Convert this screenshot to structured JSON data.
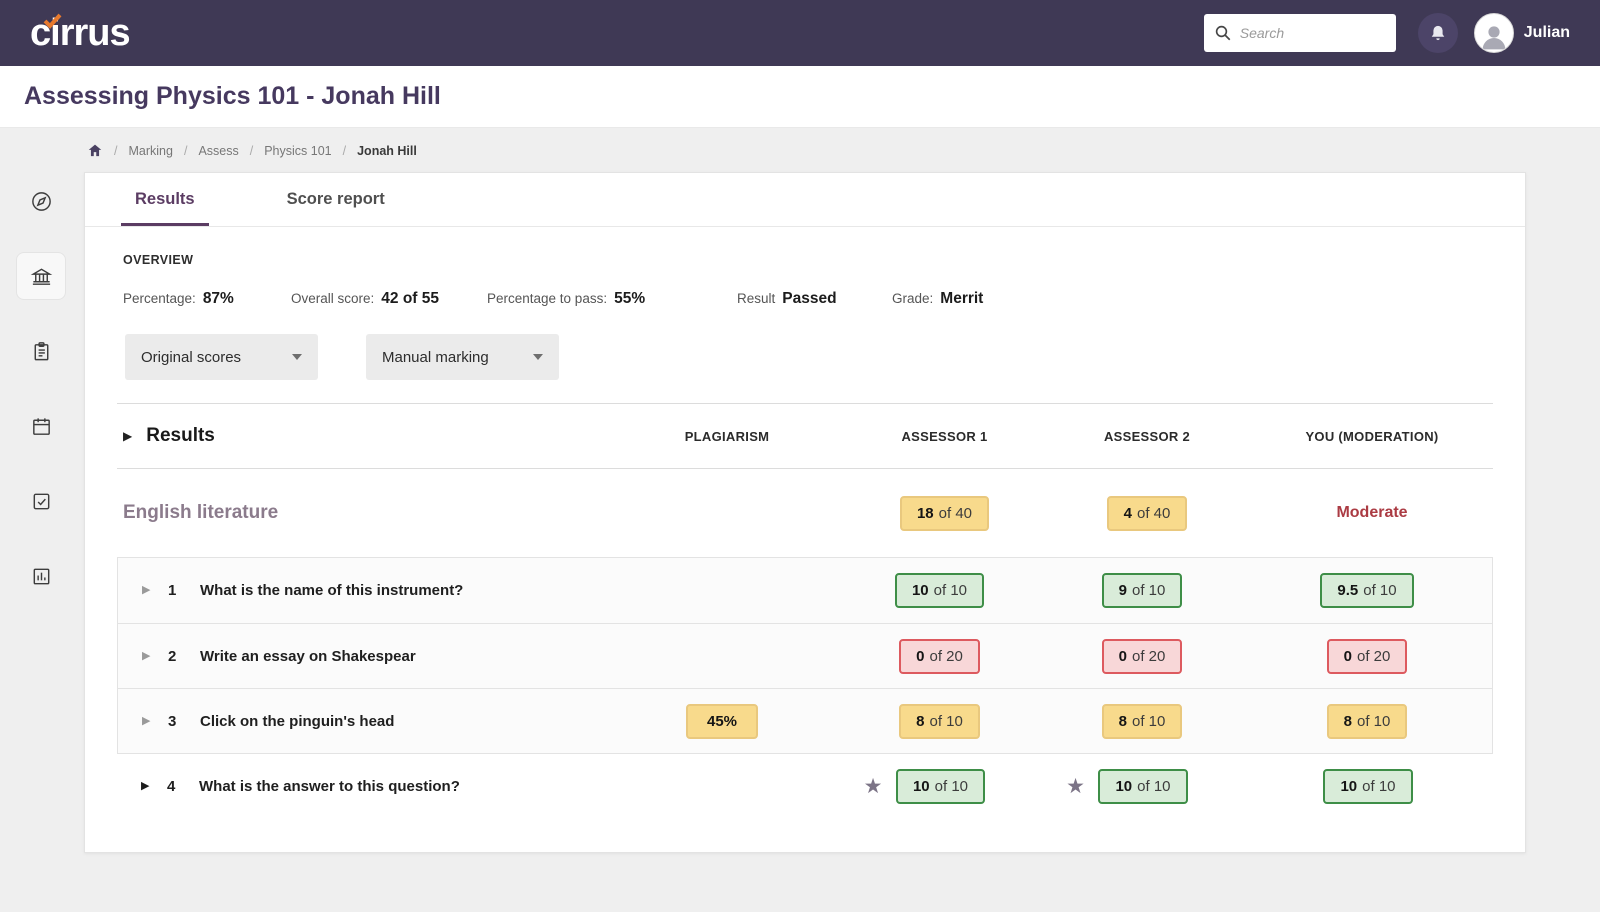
{
  "colors": {
    "topbar_bg": "#3f3955",
    "accent_purple": "#5b3c63",
    "badge_green_border": "#3e8e47",
    "badge_green_bg": "#d9ecd9",
    "badge_red_border": "#dd5a5f",
    "badge_red_bg": "#f8d7d8",
    "badge_yellow_bg": "#f8da8c",
    "moderate_red": "#ab3b43",
    "logo_check_orange": "#e87a2e"
  },
  "icons": {
    "expand_triangle": "▶",
    "star": "★"
  },
  "topbar": {
    "logo": "cirrus",
    "search_placeholder": "Search",
    "user_name": "Julian"
  },
  "page_title": "Assessing Physics 101 - Jonah Hill",
  "breadcrumb": {
    "sep": "/",
    "items": [
      "Marking",
      "Assess",
      "Physics 101",
      "Jonah Hill"
    ]
  },
  "tabs": {
    "results": "Results",
    "score_report": "Score report"
  },
  "overview": {
    "heading": "OVERVIEW",
    "percentage_label": "Percentage:",
    "percentage_value": "87%",
    "overall_label": "Overall score:",
    "overall_value": "42 of 55",
    "pass_label": "Percentage to pass:",
    "pass_value": "55%",
    "result_label": "Result",
    "result_value": "Passed",
    "grade_label": "Grade:",
    "grade_value": "Merrit"
  },
  "filters": {
    "scores": "Original scores",
    "marking": "Manual marking"
  },
  "table": {
    "section_title": "Results",
    "col_plagiarism": "PLAGIARISM",
    "col_assessor1": "ASSESSOR 1",
    "col_assessor2": "ASSESSOR 2",
    "col_you": "YOU (MODERATION)",
    "group_title": "English literature",
    "group_a1": {
      "bold": "18",
      "rest": "of 40"
    },
    "group_a2": {
      "bold": "4",
      "rest": "of 40"
    },
    "group_you": "Moderate",
    "rows": [
      {
        "num": "1",
        "question": "What is the name of this instrument?",
        "a1": {
          "bold": "10",
          "rest": "of 10"
        },
        "a2": {
          "bold": "9",
          "rest": "of 10"
        },
        "you": {
          "bold": "9.5",
          "rest": "of 10"
        }
      },
      {
        "num": "2",
        "question": "Write an essay on Shakespear",
        "a1": {
          "bold": "0",
          "rest": "of 20"
        },
        "a2": {
          "bold": "0",
          "rest": "of 20"
        },
        "you": {
          "bold": "0",
          "rest": "of 20"
        }
      },
      {
        "num": "3",
        "question": "Click on the pinguin's head",
        "plagiarism": {
          "bold": "45%",
          "rest": ""
        },
        "a1": {
          "bold": "8",
          "rest": "of 10"
        },
        "a2": {
          "bold": "8",
          "rest": "of 10"
        },
        "you": {
          "bold": "8",
          "rest": "of 10"
        }
      },
      {
        "num": "4",
        "question": "What is the answer to this question?",
        "a1": {
          "bold": "10",
          "rest": "of 10"
        },
        "a2": {
          "bold": "10",
          "rest": "of 10"
        },
        "you": {
          "bold": "10",
          "rest": "of 10"
        }
      }
    ]
  }
}
